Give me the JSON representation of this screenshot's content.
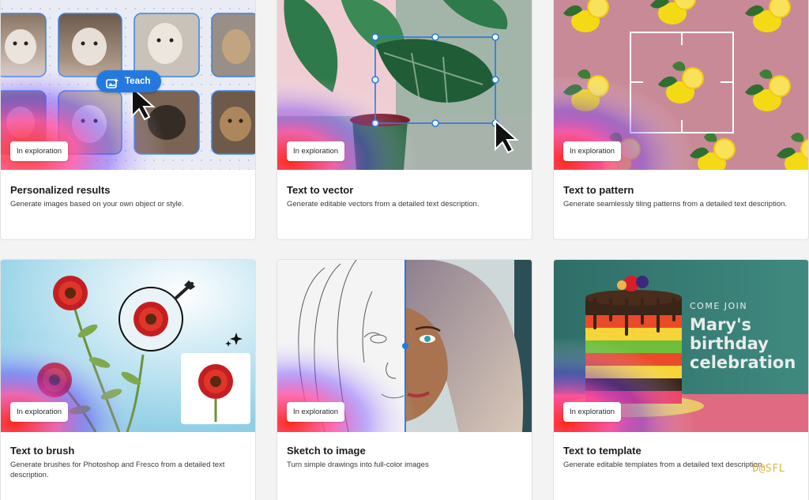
{
  "cards": [
    {
      "title": "Personalized results",
      "description": "Generate images based on your own object or style.",
      "badge": "In exploration",
      "button": "Teach"
    },
    {
      "title": "Text to vector",
      "description": "Generate editable vectors from a detailed text description.",
      "badge": "In exploration"
    },
    {
      "title": "Text to pattern",
      "description": "Generate seamlessly tiling patterns from a detailed text description.",
      "badge": "In exploration"
    },
    {
      "title": "Text to brush",
      "description": "Generate brushes for Photoshop and Fresco from a detailed text description.",
      "badge": "In exploration"
    },
    {
      "title": "Sketch to image",
      "description": "Turn simple drawings into full-color images",
      "badge": "In exploration"
    },
    {
      "title": "Text to template",
      "description": "Generate editable templates from a detailed text description.",
      "badge": "In exploration",
      "template_text": {
        "kicker": "Come join",
        "line1": "Mary's",
        "line2": "birthday",
        "line3": "celebration"
      }
    }
  ],
  "watermark": "D@SFL",
  "colors": {
    "accent_blue": "#2479e0",
    "badge_bg": "#ffffff",
    "card_bg": "#ffffff",
    "page_bg": "#f3f3f3"
  },
  "icons": [
    "teach-icon",
    "cursor-arrow-icon",
    "brush-icon",
    "sparkle-icon"
  ]
}
